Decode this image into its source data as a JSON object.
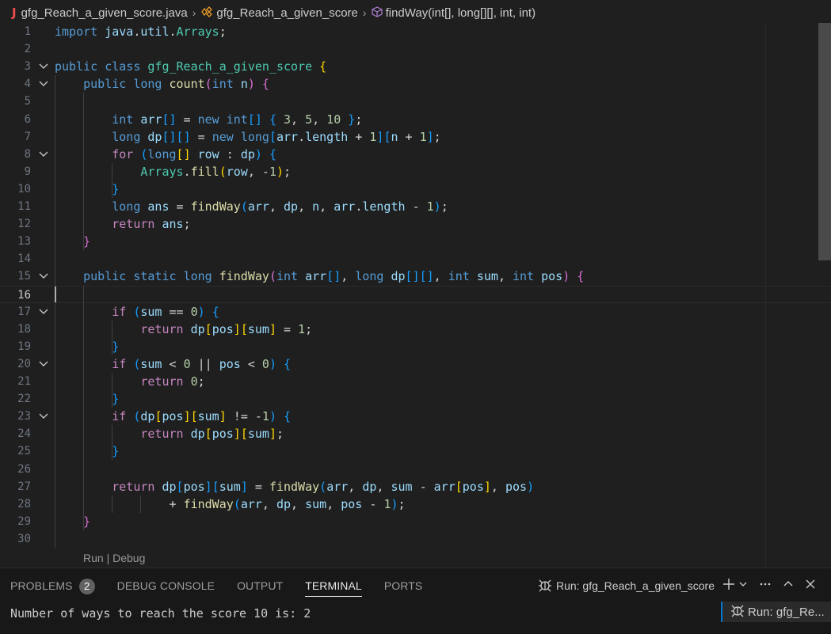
{
  "breadcrumb": {
    "file_icon": "J",
    "file": "gfg_Reach_a_given_score.java",
    "class": "gfg_Reach_a_given_score",
    "method": "findWay(int[], long[][], int, int)"
  },
  "editor": {
    "line_numbers": [
      "1",
      "2",
      "3",
      "4",
      "5",
      "6",
      "7",
      "8",
      "9",
      "10",
      "11",
      "12",
      "13",
      "14",
      "15",
      "16",
      "17",
      "18",
      "19",
      "20",
      "21",
      "22",
      "23",
      "24",
      "25",
      "26",
      "27",
      "28",
      "29",
      "30"
    ],
    "current_line": 16,
    "codelens": "Run | Debug",
    "code_lines": [
      "import java.util.Arrays;",
      "",
      "public class gfg_Reach_a_given_score {",
      "    public long count(int n) {",
      "",
      "        int arr[] = new int[] { 3, 5, 10 };",
      "        long dp[][] = new long[arr.length + 1][n + 1];",
      "        for (long[] row : dp) {",
      "            Arrays.fill(row, -1);",
      "        }",
      "        long ans = findWay(arr, dp, n, arr.length - 1);",
      "        return ans;",
      "    }",
      "",
      "    public static long findWay(int arr[], long dp[][], int sum, int pos) {",
      "",
      "        if (sum == 0) {",
      "            return dp[pos][sum] = 1;",
      "        }",
      "        if (sum < 0 || pos < 0) {",
      "            return 0;",
      "        }",
      "        if (dp[pos][sum] != -1) {",
      "            return dp[pos][sum];",
      "        }",
      "",
      "        return dp[pos][sum] = findWay(arr, dp, sum - arr[pos], pos)",
      "                + findWay(arr, dp, sum, pos - 1);",
      "    }",
      ""
    ]
  },
  "panel": {
    "tabs": [
      {
        "label": "PROBLEMS",
        "badge": "2"
      },
      {
        "label": "DEBUG CONSOLE"
      },
      {
        "label": "OUTPUT"
      },
      {
        "label": "TERMINAL",
        "active": true
      },
      {
        "label": "PORTS"
      }
    ],
    "run_label": "Run: gfg_Reach_a_given_score",
    "terminal_output": "Number of ways to reach the score 10 is: 2",
    "terminal_tab": "Run: gfg_Re..."
  },
  "icons": [
    "java-file-icon",
    "class-icon",
    "method-cube-icon",
    "fold-chevron-icon",
    "debug-icon",
    "plus-icon",
    "chevron-down-icon",
    "more-icon",
    "maximize-icon",
    "close-icon"
  ],
  "colors": {
    "background": "#1f1f1f",
    "keyword": "#569cd6",
    "control": "#c586c0",
    "type": "#4ec9b0",
    "function": "#dcdcaa",
    "variable": "#9cdcfe",
    "number": "#b5cea8",
    "accent": "#0078d4"
  }
}
